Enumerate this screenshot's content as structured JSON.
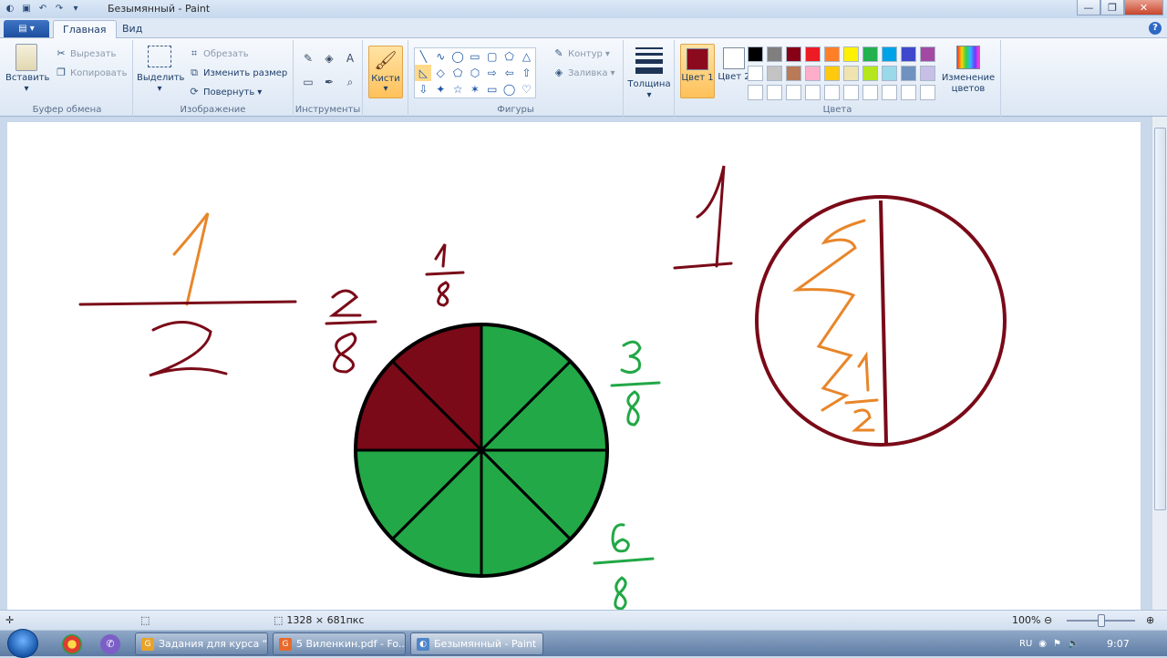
{
  "window": {
    "title": "Безымянный - Paint",
    "min": "—",
    "max": "❐",
    "close": "✕"
  },
  "qat_icons": [
    "paint-icon",
    "save-icon",
    "undo-icon",
    "redo-icon",
    "customize-qat-icon"
  ],
  "tabs": {
    "app_menu": "▤ ▾",
    "home": "Главная",
    "view": "Вид",
    "help": "?"
  },
  "ribbon": {
    "clipboard": {
      "label": "Буфер обмена",
      "paste": "Вставить",
      "cut": "Вырезать",
      "copy": "Копировать"
    },
    "image": {
      "label": "Изображение",
      "select": "Выделить",
      "crop": "Обрезать",
      "resize": "Изменить размер",
      "rotate": "Повернуть"
    },
    "tools": {
      "label": "Инструменты",
      "items": [
        "✎",
        "◈",
        "A",
        "▭",
        "✒",
        "⌕"
      ]
    },
    "brushes": "Кисти",
    "shapes": {
      "label": "Фигуры",
      "items": [
        "╲",
        "∿",
        "◯",
        "▭",
        "▢",
        "⬠",
        "△",
        "◺",
        "◇",
        "⬠",
        "⬡",
        "⇨",
        "⇦",
        "⇧",
        "⇩",
        "✦",
        "☆",
        "✶",
        "▭",
        "◯",
        "♡"
      ],
      "outline": "Контур",
      "fill": "Заливка"
    },
    "size": {
      "label": "Толщина"
    },
    "colors": {
      "label": "Цвета",
      "color1": "Цвет 1",
      "color2": "Цвет 2",
      "color1_value": "#8b0a1e",
      "color2_value": "#ffffff",
      "edit": "Изменение цветов",
      "palette": [
        "#000000",
        "#7f7f7f",
        "#880015",
        "#ed1c24",
        "#ff7f27",
        "#fff200",
        "#22b14c",
        "#00a2e8",
        "#3f48cc",
        "#a349a4",
        "#ffffff",
        "#c3c3c3",
        "#b97a57",
        "#ffaec9",
        "#ffc90e",
        "#efe4b0",
        "#b5e61d",
        "#99d9ea",
        "#7092be",
        "#c8bfe7",
        "#ffffff",
        "#ffffff",
        "#ffffff",
        "#ffffff",
        "#ffffff",
        "#ffffff",
        "#ffffff",
        "#ffffff",
        "#ffffff",
        "#ffffff"
      ]
    }
  },
  "drawing": {
    "colors": {
      "maroon": "#7a0a18",
      "orange": "#e8862a",
      "green": "#22a846",
      "black": "#000000"
    },
    "fractions": {
      "left_num": "1",
      "left_den": "2",
      "two_eighths_num": "2",
      "two_eighths_den": "8",
      "one_eighth_num": "1",
      "one_eighth_den": "8",
      "three_eighths_num": "3",
      "three_eighths_den": "8",
      "six_eighths_num": "6",
      "six_eighths_den": "8",
      "whole": "1",
      "half_num": "1",
      "half_den": "2"
    },
    "pie": {
      "total_slices": 8,
      "colored_slices": 2,
      "green_slices": 6
    }
  },
  "status": {
    "dimensions": "1328 × 681пкс",
    "zoom": "100%",
    "zoom_out": "⊖",
    "zoom_in": "⊕"
  },
  "taskbar": {
    "items": [
      {
        "label": "Задания для курса \"...",
        "icon": "G"
      },
      {
        "label": "5 Виленкин.pdf - Fo...",
        "icon": "G"
      },
      {
        "label": "Безымянный - Paint",
        "icon": "◐"
      }
    ],
    "lang": "RU",
    "clock": "9:07"
  }
}
